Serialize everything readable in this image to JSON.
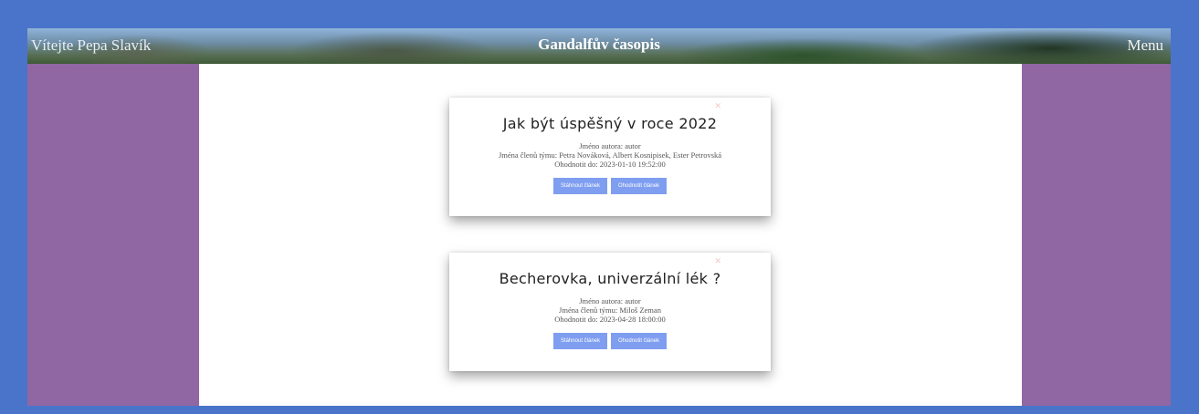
{
  "header": {
    "welcome": "Vítejte Pepa Slavík",
    "title": "Gandalfův časopis",
    "menu": "Menu"
  },
  "articles": [
    {
      "title": "Jak být úspěšný v roce 2022",
      "author": "Jméno autora: autor",
      "team": "Jména členů týmu: Petra Nováková, Albert Kosnipisek, Ester Petrovská",
      "deadline": "Ohodnotit do: 2023-01-10 19:52:00",
      "download_label": "Stáhnout článek",
      "rate_label": "Ohodnotit článek"
    },
    {
      "title": "Becherovka, univerzální lék ?",
      "author": "Jméno autora: autor",
      "team": "Jména členů týmu: Miloš Zeman",
      "deadline": "Ohodnotit do: 2023-04-28 18:00:00",
      "download_label": "Stáhnout článek",
      "rate_label": "Ohodnotit článek"
    }
  ],
  "colors": {
    "frame": "#4a74c9",
    "sidebar": "#9066a3",
    "button": "#7f9ef0"
  }
}
